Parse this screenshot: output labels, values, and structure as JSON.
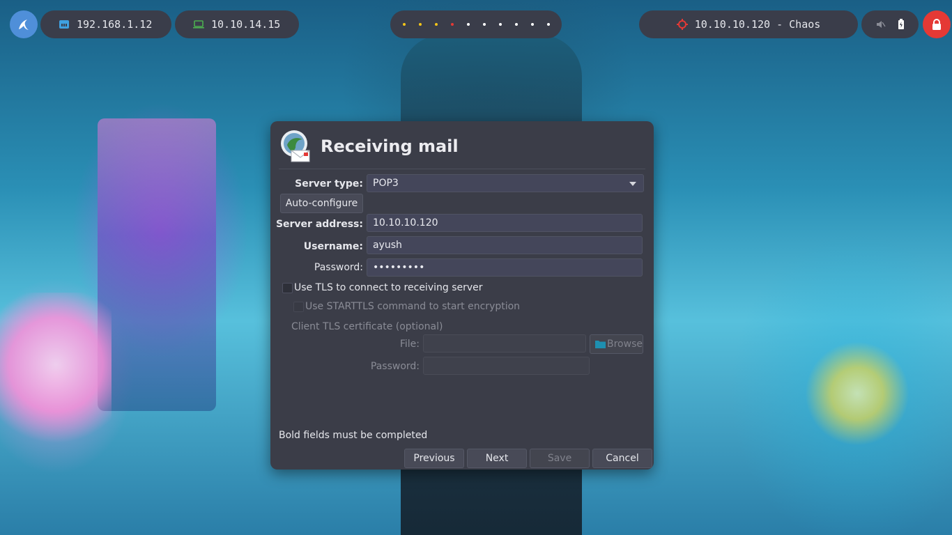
{
  "taskbar": {
    "host_ip": "192.168.1.12",
    "vpn_ip": "10.10.14.15",
    "target": "10.10.10.120 - Chaos",
    "workspace_colors": [
      "#f5c518",
      "#f5c518",
      "#f5c518",
      "#e53935",
      "#ffffff",
      "#ffffff",
      "#ffffff",
      "#ffffff",
      "#ffffff",
      "#ffffff"
    ],
    "icons": {
      "launcher": "kali-dragon-icon",
      "host": "ethernet-icon",
      "vpn": "laptop-icon",
      "target": "crosshair-icon",
      "mute": "speaker-muted-icon",
      "battery": "battery-icon",
      "lock": "lock-icon"
    },
    "accent_colors": {
      "launcher": "#4f8fd9",
      "lock": "#e53935",
      "host_icon": "#3fa0e0",
      "vpn_icon": "#4caf50",
      "target_icon": "#e53935"
    }
  },
  "dialog": {
    "title": "Receiving mail",
    "icon": "mail-client-icon",
    "server_type_label": "Server type:",
    "server_type_value": "POP3",
    "auto_configure": "Auto-configure",
    "server_address_label": "Server address:",
    "server_address_value": "10.10.10.120",
    "username_label": "Username:",
    "username_value": "ayush",
    "password_label": "Password:",
    "password_value": "•••••••••",
    "use_tls": "Use TLS to connect to receiving server",
    "use_starttls": "Use STARTTLS command to start encryption",
    "client_cert_label": "Client TLS certificate (optional)",
    "file_label": "File:",
    "browse": "Browse",
    "cert_password_label": "Password:",
    "hint": "Bold fields must be completed",
    "buttons": {
      "previous": "Previous",
      "next": "Next",
      "save": "Save",
      "cancel": "Cancel"
    }
  }
}
